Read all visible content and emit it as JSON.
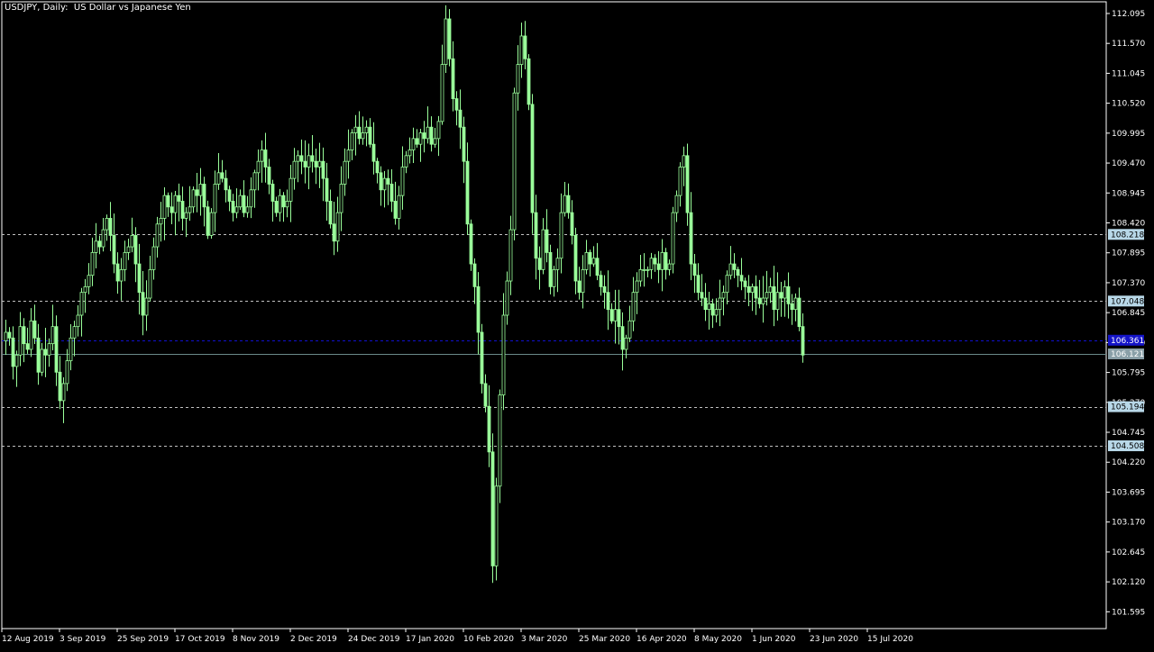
{
  "window": {
    "title": "USDJPY, Daily:  US Dollar vs Japanese Yen"
  },
  "colors": {
    "background": "#000000",
    "frame": "#ffffff",
    "candle": "#9aff9a",
    "level_line": "#c0c0c0",
    "bid_line": "#1010d0",
    "bid_label_bg": "#1414c8",
    "price_label_bg": "#b8d8e8",
    "price_label_fg": "#000000",
    "current_label_bg": "#8aa0a8"
  },
  "chart_data": {
    "type": "candlestick",
    "symbol": "USDJPY",
    "timeframe": "Daily",
    "ylim": [
      101.3,
      112.3
    ],
    "y_ticks": [
      "112.095",
      "111.570",
      "111.045",
      "110.520",
      "109.995",
      "109.470",
      "108.945",
      "108.420",
      "107.895",
      "107.370",
      "106.845",
      "106.320",
      "105.795",
      "105.270",
      "104.745",
      "104.220",
      "103.695",
      "103.170",
      "102.645",
      "102.120",
      "101.595"
    ],
    "x_ticks": [
      "12 Aug 2019",
      "3 Sep 2019",
      "25 Sep 2019",
      "17 Oct 2019",
      "8 Nov 2019",
      "2 Dec 2019",
      "24 Dec 2019",
      "17 Jan 2020",
      "10 Feb 2020",
      "3 Mar 2020",
      "25 Mar 2020",
      "16 Apr 2020",
      "8 May 2020",
      "1 Jun 2020",
      "23 Jun 2020",
      "15 Jul 2020"
    ],
    "x_tick_index": [
      0,
      16,
      32,
      48,
      64,
      80,
      96,
      112,
      128,
      144,
      160,
      176,
      192,
      208,
      224,
      240
    ],
    "close_series": [
      106.5,
      106.4,
      105.9,
      106.1,
      106.6,
      106.3,
      106.2,
      106.7,
      106.4,
      105.8,
      106.2,
      106.1,
      106.3,
      106.6,
      105.8,
      105.3,
      105.6,
      106.0,
      106.4,
      106.6,
      106.8,
      107.2,
      107.3,
      107.5,
      107.9,
      108.1,
      108.0,
      108.3,
      108.5,
      108.2,
      107.7,
      107.4,
      107.6,
      107.9,
      108.0,
      108.2,
      107.7,
      107.2,
      106.8,
      107.1,
      107.6,
      108.0,
      108.4,
      108.5,
      108.9,
      108.7,
      108.6,
      108.9,
      108.8,
      108.5,
      108.6,
      108.7,
      109.0,
      108.9,
      109.1,
      108.7,
      108.2,
      108.6,
      109.1,
      109.3,
      109.2,
      109.0,
      108.8,
      108.6,
      108.7,
      108.9,
      108.6,
      108.7,
      109.0,
      109.3,
      109.5,
      109.7,
      109.4,
      109.1,
      108.8,
      108.6,
      108.9,
      108.7,
      108.8,
      109.2,
      109.5,
      109.6,
      109.5,
      109.4,
      109.6,
      109.5,
      109.4,
      109.5,
      109.2,
      108.8,
      108.4,
      108.1,
      108.6,
      109.1,
      109.5,
      109.7,
      110.0,
      110.1,
      109.9,
      110.0,
      110.1,
      109.8,
      109.5,
      109.3,
      109.0,
      109.2,
      109.1,
      108.8,
      108.5,
      108.9,
      109.4,
      109.6,
      109.7,
      109.9,
      109.8,
      110.0,
      109.9,
      110.1,
      109.8,
      109.9,
      110.2,
      111.2,
      112.0,
      111.3,
      110.6,
      110.4,
      110.1,
      109.5,
      108.4,
      107.7,
      107.3,
      106.5,
      105.6,
      105.2,
      104.4,
      102.4,
      103.8,
      105.4,
      106.8,
      107.4,
      108.3,
      110.7,
      111.2,
      111.7,
      111.3,
      110.5,
      108.6,
      107.8,
      107.6,
      108.3,
      107.9,
      107.3,
      107.6,
      107.8,
      108.6,
      108.9,
      108.6,
      108.2,
      107.4,
      107.2,
      107.6,
      107.9,
      107.7,
      107.8,
      107.5,
      107.3,
      107.2,
      106.9,
      106.7,
      106.9,
      106.6,
      106.2,
      106.4,
      106.7,
      107.2,
      107.4,
      107.6,
      107.6,
      107.6,
      107.8,
      107.7,
      107.6,
      107.9,
      107.6,
      107.7,
      108.6,
      108.9,
      109.4,
      109.6,
      108.6,
      107.7,
      107.5,
      107.2,
      107.1,
      106.9,
      107.0,
      106.8,
      106.9,
      107.1,
      107.2,
      107.5,
      107.7,
      107.6,
      107.5,
      107.4,
      107.3,
      107.2,
      107.3,
      107.1,
      107.0,
      107.1,
      107.2,
      107.3,
      106.9,
      107.2,
      107.1,
      107.3,
      107.0,
      106.9,
      107.1,
      106.6,
      106.1
    ],
    "levels": [
      {
        "name": "resistance-1",
        "value": "108.218"
      },
      {
        "name": "resistance-2",
        "value": "107.048"
      },
      {
        "name": "bid",
        "value": "106.361"
      },
      {
        "name": "current",
        "value": "106.121"
      },
      {
        "name": "support-1",
        "value": "105.194"
      },
      {
        "name": "support-2",
        "value": "104.508"
      }
    ]
  }
}
